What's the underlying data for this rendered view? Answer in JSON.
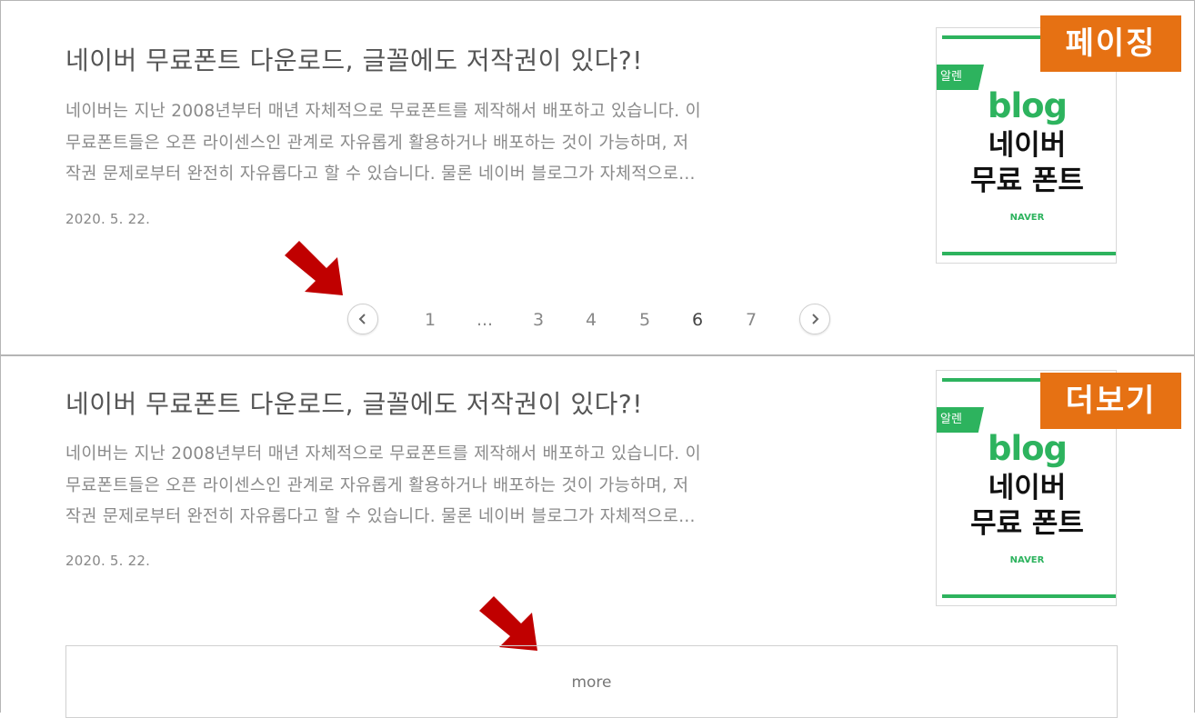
{
  "paging": {
    "post": {
      "title": "네이버 무료폰트 다운로드, 글꼴에도 저작권이 있다?!",
      "excerpt": [
        "네이버는 지난 2008년부터 매년 자체적으로 무료폰트를 제작해서 배포하고 있습니다. 이",
        "무료폰트들은 오픈 라이센스인 관계로 자유롭게 활용하거나 배포하는 것이 가능하며, 저",
        "작권 문제로부터 완전히 자유롭다고 할 수 있습니다. 물론 네이버 블로그가 자체적으로..."
      ],
      "date": "2020. 5. 22."
    },
    "thumbnail": {
      "tag": "알렌",
      "logo": "blog",
      "title_line1": "네이버",
      "title_line2": "무료 폰트",
      "brand": "NAVER"
    },
    "badge": "페이징",
    "pagination": {
      "pages": [
        "1",
        "...",
        "3",
        "4",
        "5",
        "6",
        "7"
      ],
      "current": "6",
      "prev_icon": "chevron-left-icon",
      "next_icon": "chevron-right-icon"
    }
  },
  "more": {
    "post": {
      "title": "네이버 무료폰트 다운로드, 글꼴에도 저작권이 있다?!",
      "excerpt": [
        "네이버는 지난 2008년부터 매년 자체적으로 무료폰트를 제작해서 배포하고 있습니다. 이",
        "무료폰트들은 오픈 라이센스인 관계로 자유롭게 활용하거나 배포하는 것이 가능하며, 저",
        "작권 문제로부터 완전히 자유롭다고 할 수 있습니다. 물론 네이버 블로그가 자체적으로..."
      ],
      "date": "2020. 5. 22."
    },
    "thumbnail": {
      "tag": "알렌",
      "logo": "blog",
      "title_line1": "네이버",
      "title_line2": "무료 폰트",
      "brand": "NAVER"
    },
    "badge": "더보기",
    "more_label": "more"
  },
  "colors": {
    "badge": "#e67113",
    "arrow": "#c00000",
    "brand_green": "#2db35e"
  },
  "icons": {
    "annotation_arrow": "arrow-down-right-icon"
  }
}
